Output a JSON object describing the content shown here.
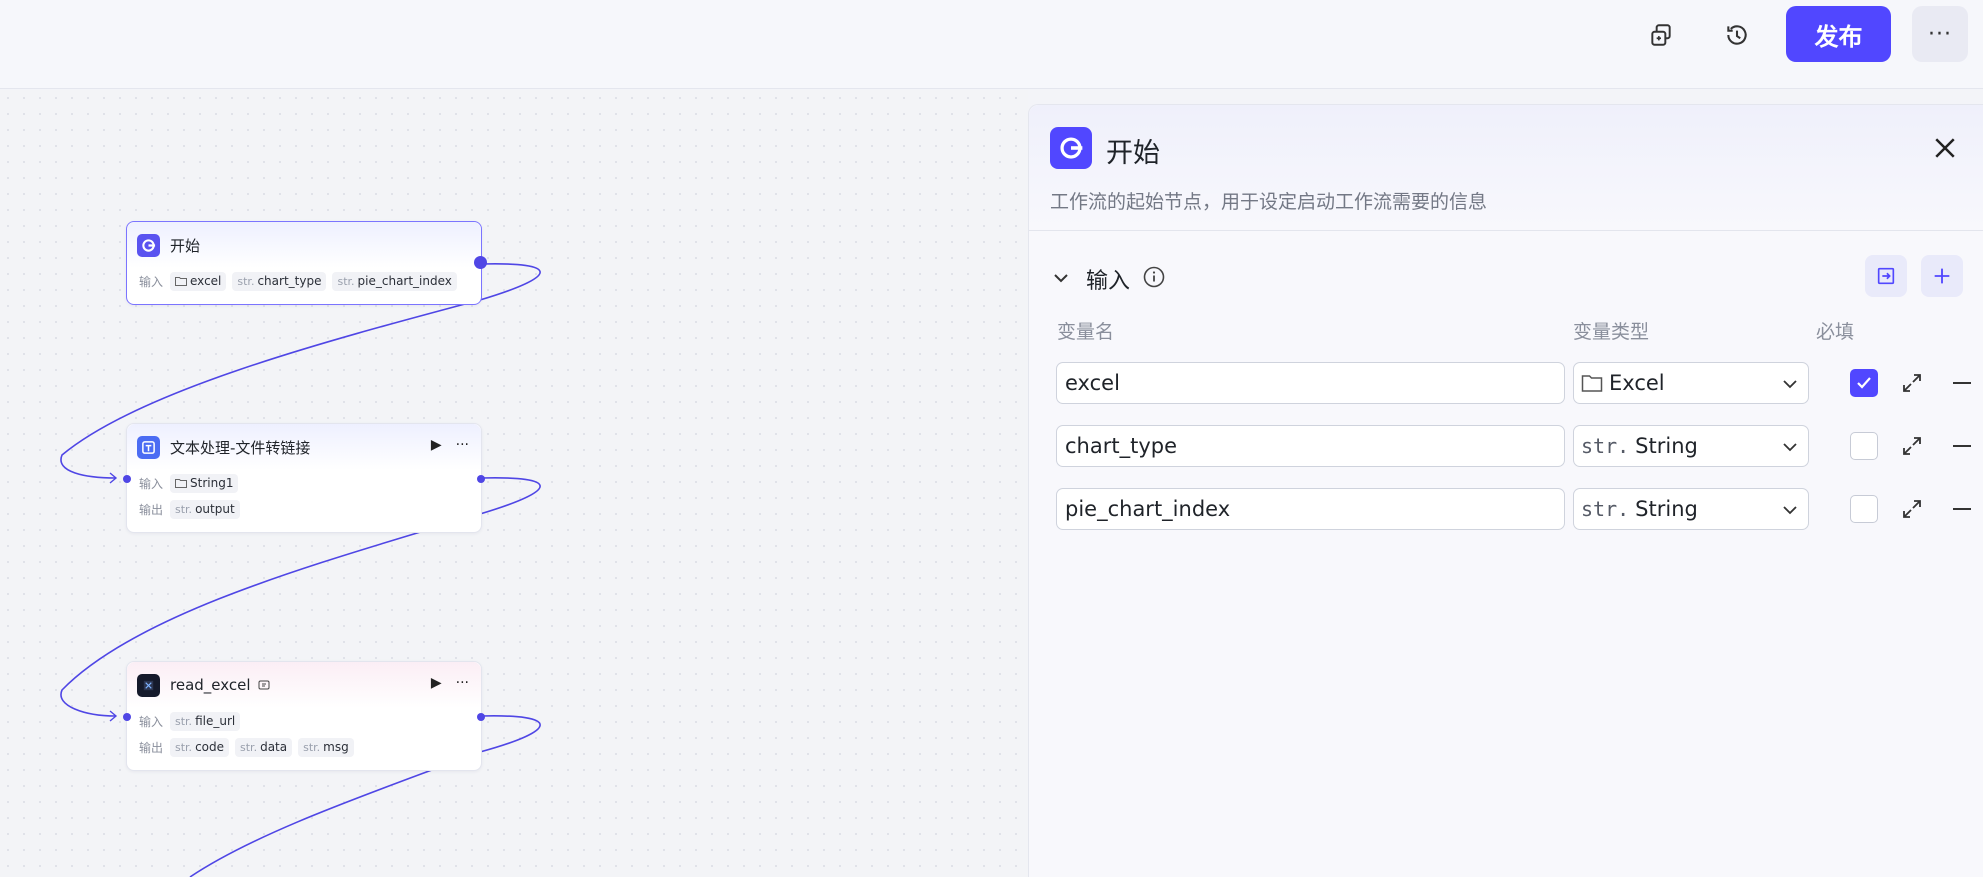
{
  "topbar": {
    "copy_icon": "copy-icon",
    "history_icon": "history-icon",
    "publish_label": "发布",
    "more_label": "···"
  },
  "canvas": {
    "nodes": [
      {
        "title": "开始",
        "icon": "start-icon",
        "input_label": "输入",
        "inputs": [
          {
            "type": "folder",
            "name": "excel"
          },
          {
            "type": "str.",
            "name": "chart_type"
          },
          {
            "type": "str.",
            "name": "pie_chart_index"
          }
        ]
      },
      {
        "title": "文本处理-文件转链接",
        "icon": "text-process-icon",
        "input_label": "输入",
        "output_label": "输出",
        "inputs": [
          {
            "type": "folder",
            "name": "String1"
          }
        ],
        "outputs": [
          {
            "type": "str.",
            "name": "output"
          }
        ]
      },
      {
        "title": "read_excel",
        "icon": "plugin-icon",
        "input_label": "输入",
        "output_label": "输出",
        "inputs": [
          {
            "type": "str.",
            "name": "file_url"
          }
        ],
        "outputs": [
          {
            "type": "str.",
            "name": "code"
          },
          {
            "type": "str.",
            "name": "data"
          },
          {
            "type": "str.",
            "name": "msg"
          }
        ]
      }
    ]
  },
  "panel": {
    "title": "开始",
    "description": "工作流的起始节点，用于设定启动工作流需要的信息",
    "section_title": "输入",
    "columns": {
      "name": "变量名",
      "type": "变量类型",
      "required": "必填"
    },
    "variables": [
      {
        "name": "excel",
        "type_prefix": "folder",
        "type": "Excel",
        "required": true
      },
      {
        "name": "chart_type",
        "type_prefix": "str.",
        "type": "String",
        "required": false
      },
      {
        "name": "pie_chart_index",
        "type_prefix": "str.",
        "type": "String",
        "required": false
      }
    ]
  },
  "colors": {
    "accent": "#5147ff",
    "edge": "#4f46e5"
  }
}
